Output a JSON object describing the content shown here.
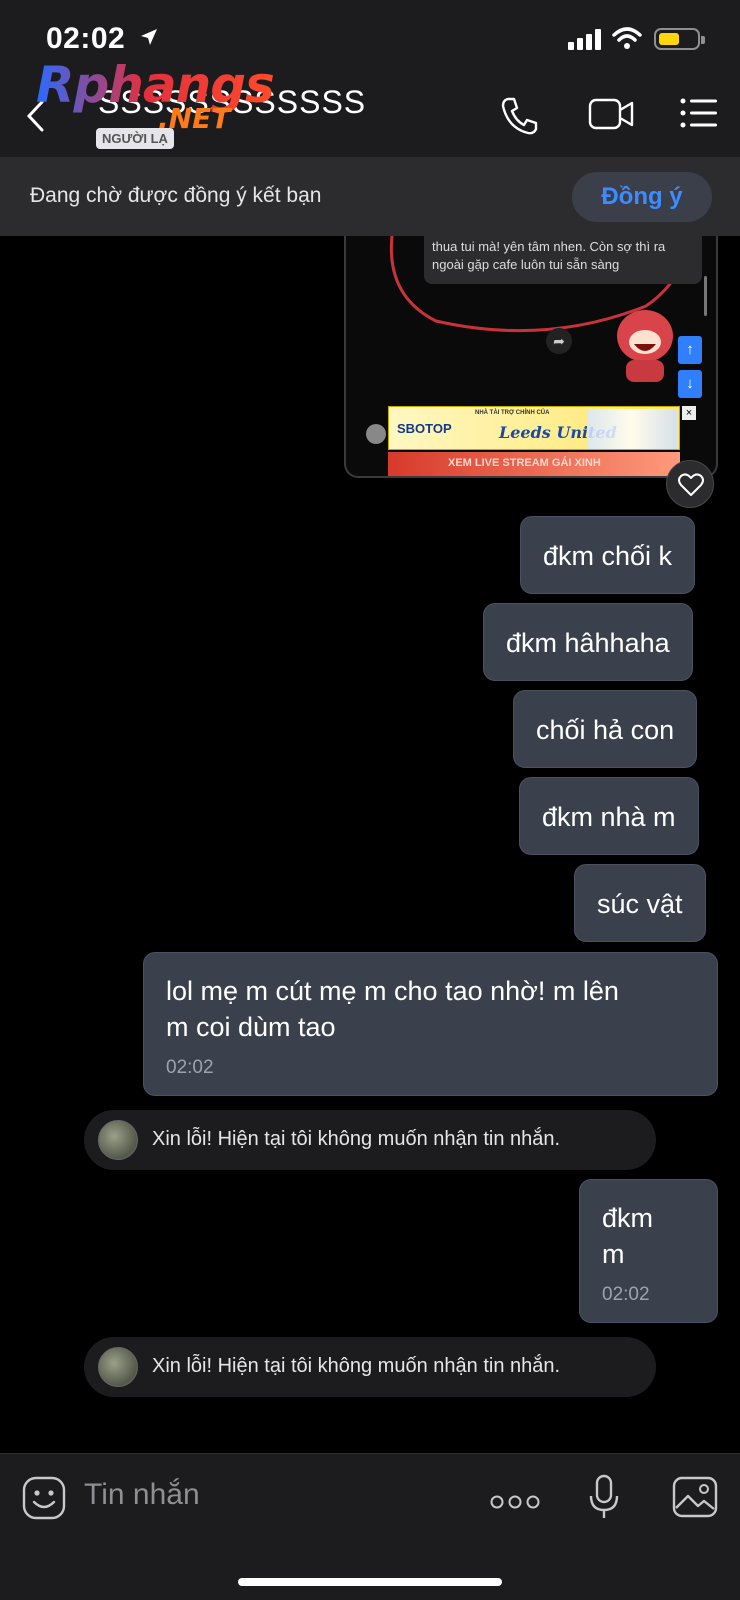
{
  "status_bar": {
    "time": "02:02"
  },
  "header": {
    "contact_name": "SSSSSSSSSSSS",
    "stranger_badge": "NGƯỜI LẠ",
    "watermark": "Rphangs",
    "watermark_suffix": ".NET"
  },
  "pending": {
    "text": "Đang chờ được đồng ý kết bạn",
    "accept_label": "Đồng ý"
  },
  "attachment": {
    "inner_message": "thua tui mà! yên tâm nhen. Còn sợ thì ra ngoài gặp cafe luôn tui sẵn sàng",
    "ad_brand": "SBOTOP",
    "ad_sponsor": "NHÀ TÀI TRỢ CHÍNH CỦA",
    "ad_team": "Leeds United",
    "ad2_text": "XEM LIVE STREAM GÁI XINH"
  },
  "messages": [
    {
      "text": "đkm chối k"
    },
    {
      "text": "đkm hâhhaha"
    },
    {
      "text": "chối hả con"
    },
    {
      "text": "đkm nhà m"
    },
    {
      "text": "súc vật"
    },
    {
      "text": "lol mẹ m cút mẹ m cho tao nhờ! m lên m coi dùm tao",
      "line1": "lol mẹ m cút mẹ m cho tao nhờ! m lên",
      "line2": "m coi dùm tao",
      "time": "02:02"
    },
    {
      "text": "đkm m",
      "line1": "đkm",
      "line2": "m",
      "time": "02:02"
    }
  ],
  "notices": [
    {
      "text": "Xin lỗi! Hiện tại tôi không muốn nhận tin nhắn."
    },
    {
      "text": "Xin lỗi! Hiện tại tôi không muốn nhận tin nhắn."
    }
  ],
  "composer": {
    "placeholder": "Tin nhắn"
  },
  "colors": {
    "bubble": "#3a414d",
    "accent": "#3d8bff",
    "background": "#000000"
  }
}
